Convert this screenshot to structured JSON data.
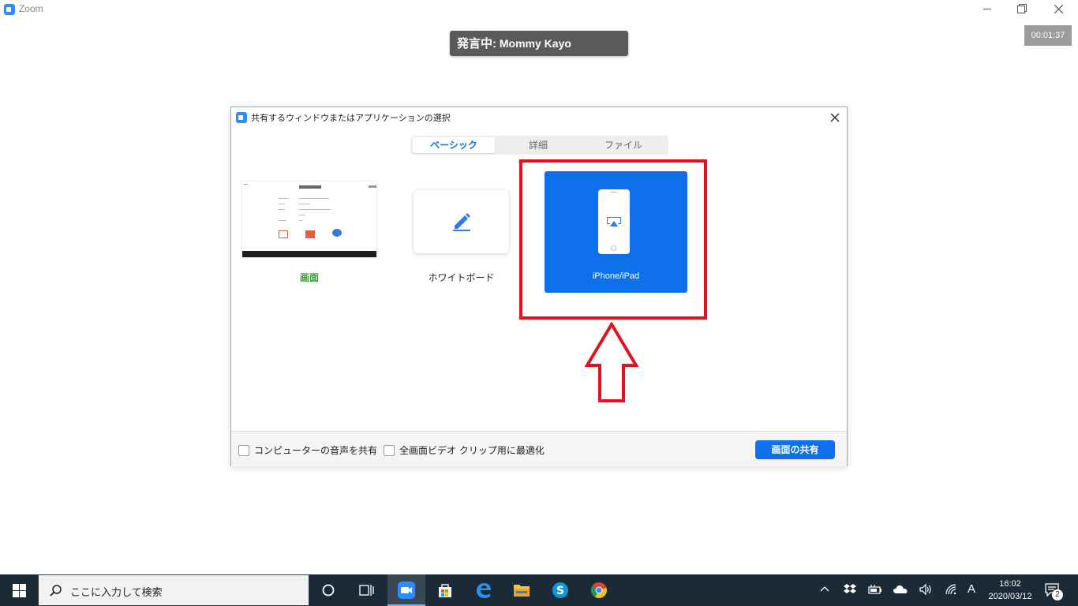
{
  "window": {
    "title": "Zoom"
  },
  "speaker": {
    "prefix": "発言中:",
    "name": "Mommy Kayo"
  },
  "timer": "00:01:37",
  "dialog": {
    "title": "共有するウィンドウまたはアプリケーションの選択",
    "tabs": [
      {
        "label": "ベーシック",
        "active": true
      },
      {
        "label": "詳細",
        "active": false
      },
      {
        "label": "ファイル",
        "active": false
      }
    ],
    "options": {
      "screen": "画面",
      "whiteboard": "ホワイトボード",
      "iphone": "iPhone/iPad"
    },
    "footer": {
      "share_audio": "コンピューターの音声を共有",
      "optimize_video": "全画面ビデオ クリップ用に最適化",
      "share_button": "画面の共有"
    }
  },
  "taskbar": {
    "search_placeholder": "ここに入力して検索",
    "clock_time": "16:02",
    "clock_date": "2020/03/12",
    "ime": "A",
    "notifications": "2"
  },
  "colors": {
    "accent": "#0e71eb",
    "highlight": "#e0141e",
    "screen_label": "#2aa02a",
    "taskbar": "#1b2a36"
  }
}
